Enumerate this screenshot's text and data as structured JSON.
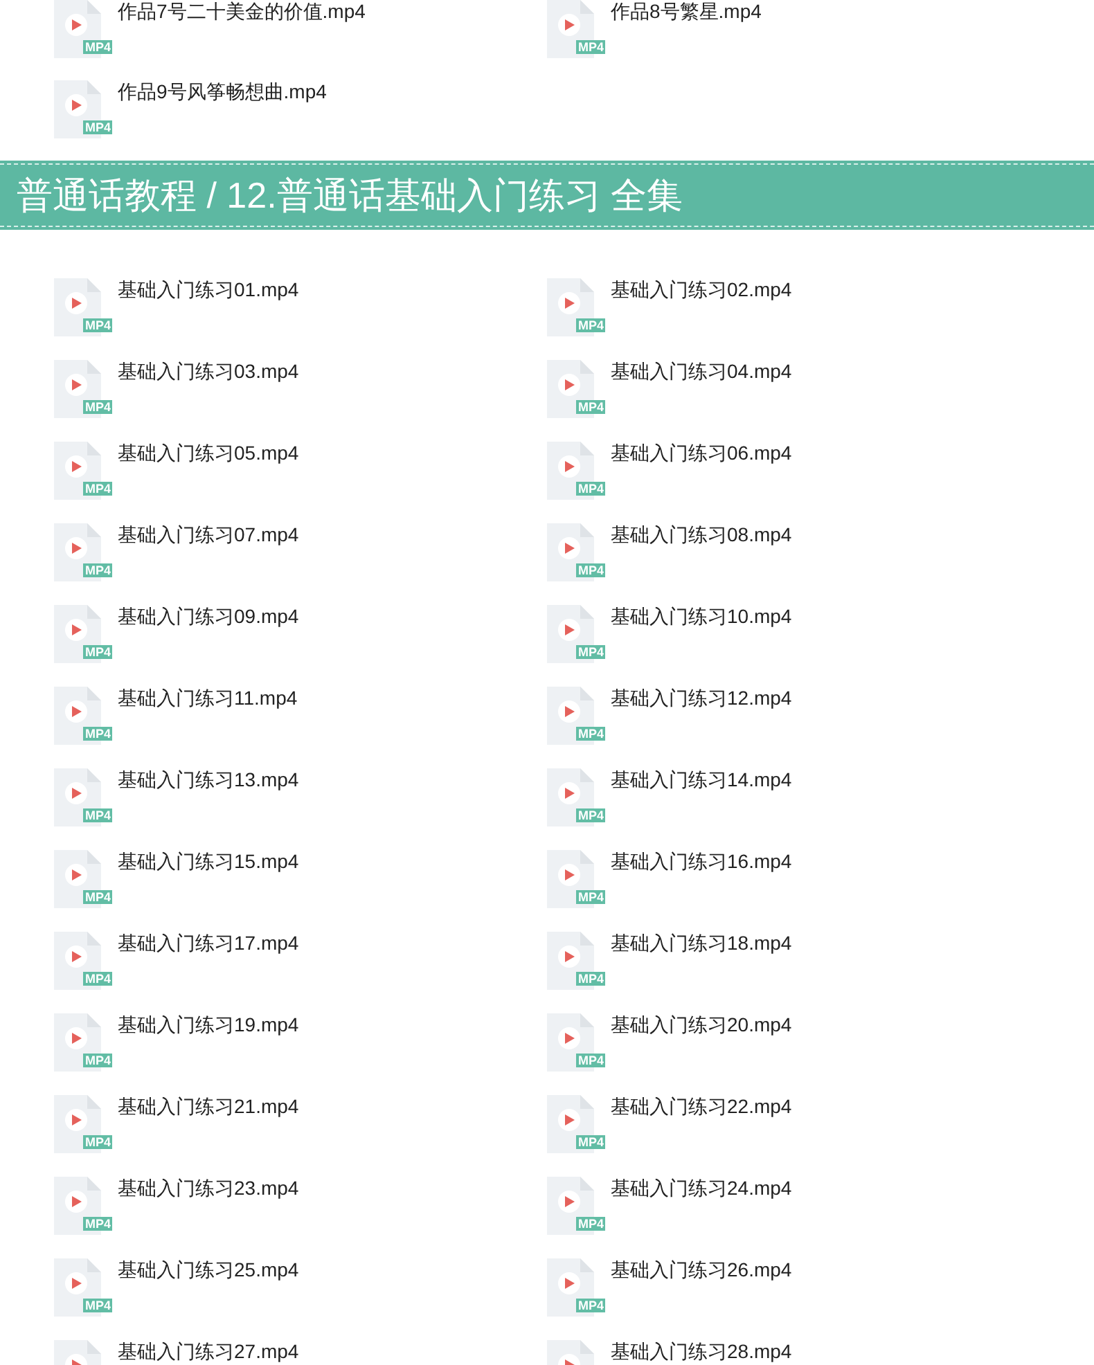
{
  "top_files": [
    {
      "name": "作品7号二十美金的价值.mp4",
      "badge": "MP4"
    },
    {
      "name": "作品8号繁星.mp4",
      "badge": "MP4"
    },
    {
      "name": "作品9号风筝畅想曲.mp4",
      "badge": "MP4"
    }
  ],
  "section": {
    "title": "普通话教程 / 12.普通话基础入门练习 全集",
    "files": [
      {
        "name": "基础入门练习01.mp4",
        "badge": "MP4"
      },
      {
        "name": "基础入门练习02.mp4",
        "badge": "MP4"
      },
      {
        "name": "基础入门练习03.mp4",
        "badge": "MP4"
      },
      {
        "name": "基础入门练习04.mp4",
        "badge": "MP4"
      },
      {
        "name": "基础入门练习05.mp4",
        "badge": "MP4"
      },
      {
        "name": "基础入门练习06.mp4",
        "badge": "MP4"
      },
      {
        "name": "基础入门练习07.mp4",
        "badge": "MP4"
      },
      {
        "name": "基础入门练习08.mp4",
        "badge": "MP4"
      },
      {
        "name": "基础入门练习09.mp4",
        "badge": "MP4"
      },
      {
        "name": "基础入门练习10.mp4",
        "badge": "MP4"
      },
      {
        "name": "基础入门练习11.mp4",
        "badge": "MP4"
      },
      {
        "name": "基础入门练习12.mp4",
        "badge": "MP4"
      },
      {
        "name": "基础入门练习13.mp4",
        "badge": "MP4"
      },
      {
        "name": "基础入门练习14.mp4",
        "badge": "MP4"
      },
      {
        "name": "基础入门练习15.mp4",
        "badge": "MP4"
      },
      {
        "name": "基础入门练习16.mp4",
        "badge": "MP4"
      },
      {
        "name": "基础入门练习17.mp4",
        "badge": "MP4"
      },
      {
        "name": "基础入门练习18.mp4",
        "badge": "MP4"
      },
      {
        "name": "基础入门练习19.mp4",
        "badge": "MP4"
      },
      {
        "name": "基础入门练习20.mp4",
        "badge": "MP4"
      },
      {
        "name": "基础入门练习21.mp4",
        "badge": "MP4"
      },
      {
        "name": "基础入门练习22.mp4",
        "badge": "MP4"
      },
      {
        "name": "基础入门练习23.mp4",
        "badge": "MP4"
      },
      {
        "name": "基础入门练习24.mp4",
        "badge": "MP4"
      },
      {
        "name": "基础入门练习25.mp4",
        "badge": "MP4"
      },
      {
        "name": "基础入门练习26.mp4",
        "badge": "MP4"
      },
      {
        "name": "基础入门练习27.mp4"
      },
      {
        "name": "基础入门练习28.mp4"
      }
    ]
  }
}
